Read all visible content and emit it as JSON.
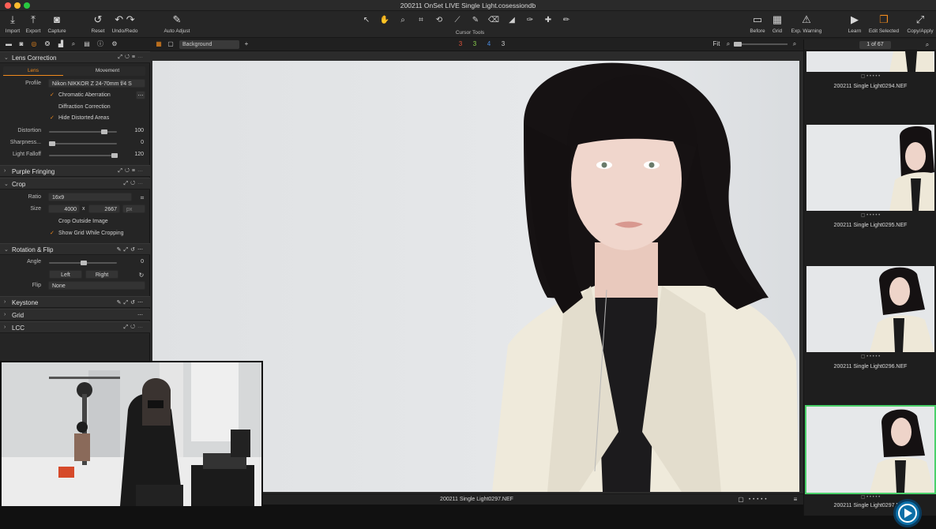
{
  "app": {
    "window_title": "200211 OnSet LIVE Single Light.cosessiondb"
  },
  "toolbar": {
    "import": "Import",
    "export": "Export",
    "capture": "Capture",
    "reset": "Reset",
    "undo_redo": "Undo/Redo",
    "auto_adjust": "Auto Adjust",
    "cursor_tools_label": "Cursor Tools",
    "before": "Before",
    "grid": "Grid",
    "exp_warning": "Exp. Warning",
    "learn": "Learn",
    "edit_selected": "Edit Selected",
    "copy_apply": "Copy/Apply"
  },
  "subbar": {
    "layer_select": "Background",
    "ratings": [
      "3",
      "3",
      "4",
      "3"
    ],
    "fit": "Fit"
  },
  "lens": {
    "section": "Lens Correction",
    "tab_lens": "Lens",
    "tab_movement": "Movement",
    "profile_label": "Profile",
    "profile_value": "Nikon NIKKOR Z 24-70mm f/4 S",
    "chromatic": "Chromatic Aberration",
    "diffraction": "Diffraction Correction",
    "hide_distorted": "Hide Distorted Areas",
    "distortion_label": "Distortion",
    "distortion_value": "100",
    "sharpness_label": "Sharpness...",
    "sharpness_value": "0",
    "falloff_label": "Light Falloff",
    "falloff_value": "120"
  },
  "purple": {
    "section": "Purple Fringing"
  },
  "crop": {
    "section": "Crop",
    "ratio_label": "Ratio",
    "ratio_value": "16x9",
    "size_label": "Size",
    "width": "4000",
    "x": "x",
    "height": "2667",
    "unit": "px",
    "crop_outside": "Crop Outside Image",
    "show_grid": "Show Grid While Cropping"
  },
  "rotation": {
    "section": "Rotation & Flip",
    "angle_label": "Angle",
    "angle_value": "0",
    "left": "Left",
    "right": "Right",
    "flip_label": "Flip",
    "flip_value": "None"
  },
  "keystone": {
    "section": "Keystone"
  },
  "grid": {
    "section": "Grid"
  },
  "lcc": {
    "section": "LCC"
  },
  "viewer": {
    "filename": "200211 Single Light0297.NEF"
  },
  "browser": {
    "count": "1 of 67",
    "items": [
      {
        "name": "200211 Single Light0294.NEF"
      },
      {
        "name": "200211 Single Light0295.NEF"
      },
      {
        "name": "200211 Single Light0296.NEF"
      },
      {
        "name": "200211 Single Light0297.NEF"
      }
    ]
  },
  "colors": {
    "accent": "#f08a1d",
    "selected": "#4ad06a"
  }
}
